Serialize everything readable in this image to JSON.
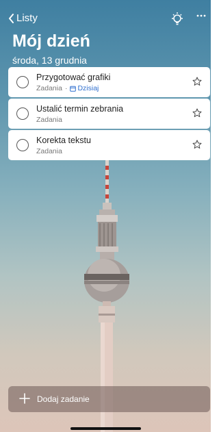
{
  "nav": {
    "back_label": "Listy"
  },
  "header": {
    "title": "Mój dzień",
    "date": "środa, 13 grudnia"
  },
  "tasks": [
    {
      "title": "Przygotować grafiki",
      "list": "Zadania",
      "due": "Dzisiaj"
    },
    {
      "title": "Ustalić termin zebrania",
      "list": "Zadania"
    },
    {
      "title": "Korekta tekstu",
      "list": "Zadania"
    }
  ],
  "add_task": {
    "label": "Dodaj zadanie"
  },
  "colors": {
    "accent": "#2f6fcf",
    "sky_top": "#3f7fa1",
    "sky_bottom": "#ddc5b9"
  }
}
